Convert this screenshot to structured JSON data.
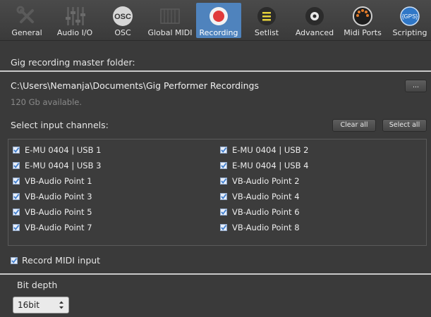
{
  "toolbar": {
    "tabs": [
      {
        "label": "General",
        "icon": "wrench-screwdriver-icon"
      },
      {
        "label": "Audio I/O",
        "icon": "faders-icon"
      },
      {
        "label": "OSC",
        "icon": "osc-icon",
        "icon_text": "OSC"
      },
      {
        "label": "Global MIDI",
        "icon": "piano-keys-icon"
      },
      {
        "label": "Recording",
        "icon": "record-icon",
        "active": true
      },
      {
        "label": "Setlist",
        "icon": "setlist-icon"
      },
      {
        "label": "Advanced",
        "icon": "gear-icon"
      },
      {
        "label": "Midi Ports",
        "icon": "midi-port-icon"
      },
      {
        "label": "Scripting",
        "icon": "gps-icon",
        "icon_text": "{GPS}"
      }
    ]
  },
  "recording": {
    "master_folder_title": "Gig recording master folder:",
    "path": "C:\\Users\\Nemanja\\Documents\\Gig Performer Recordings",
    "browse_label": "...",
    "available": "120 Gb available.",
    "input_channels_title": "Select input channels:",
    "clear_all_label": "Clear all",
    "select_all_label": "Select all",
    "channels": [
      {
        "label": "E-MU 0404 | USB 1",
        "checked": true
      },
      {
        "label": "E-MU 0404 | USB 2",
        "checked": true
      },
      {
        "label": "E-MU 0404 | USB 3",
        "checked": true
      },
      {
        "label": "E-MU 0404 | USB 4",
        "checked": true
      },
      {
        "label": "VB-Audio Point 1",
        "checked": true
      },
      {
        "label": "VB-Audio Point 2",
        "checked": true
      },
      {
        "label": "VB-Audio Point 3",
        "checked": true
      },
      {
        "label": "VB-Audio Point 4",
        "checked": true
      },
      {
        "label": "VB-Audio Point 5",
        "checked": true
      },
      {
        "label": "VB-Audio Point 6",
        "checked": true
      },
      {
        "label": "VB-Audio Point 7",
        "checked": true
      },
      {
        "label": "VB-Audio Point 8",
        "checked": true
      }
    ],
    "record_midi_label": "Record MIDI input",
    "record_midi_checked": true,
    "bit_depth_label": "Bit depth",
    "bit_depth_value": "16bit"
  },
  "colors": {
    "accent": "#4f83bd",
    "record_red": "#e03a3a",
    "background": "#3a3a3a",
    "checkbox_blue": "#3f7fd0"
  }
}
